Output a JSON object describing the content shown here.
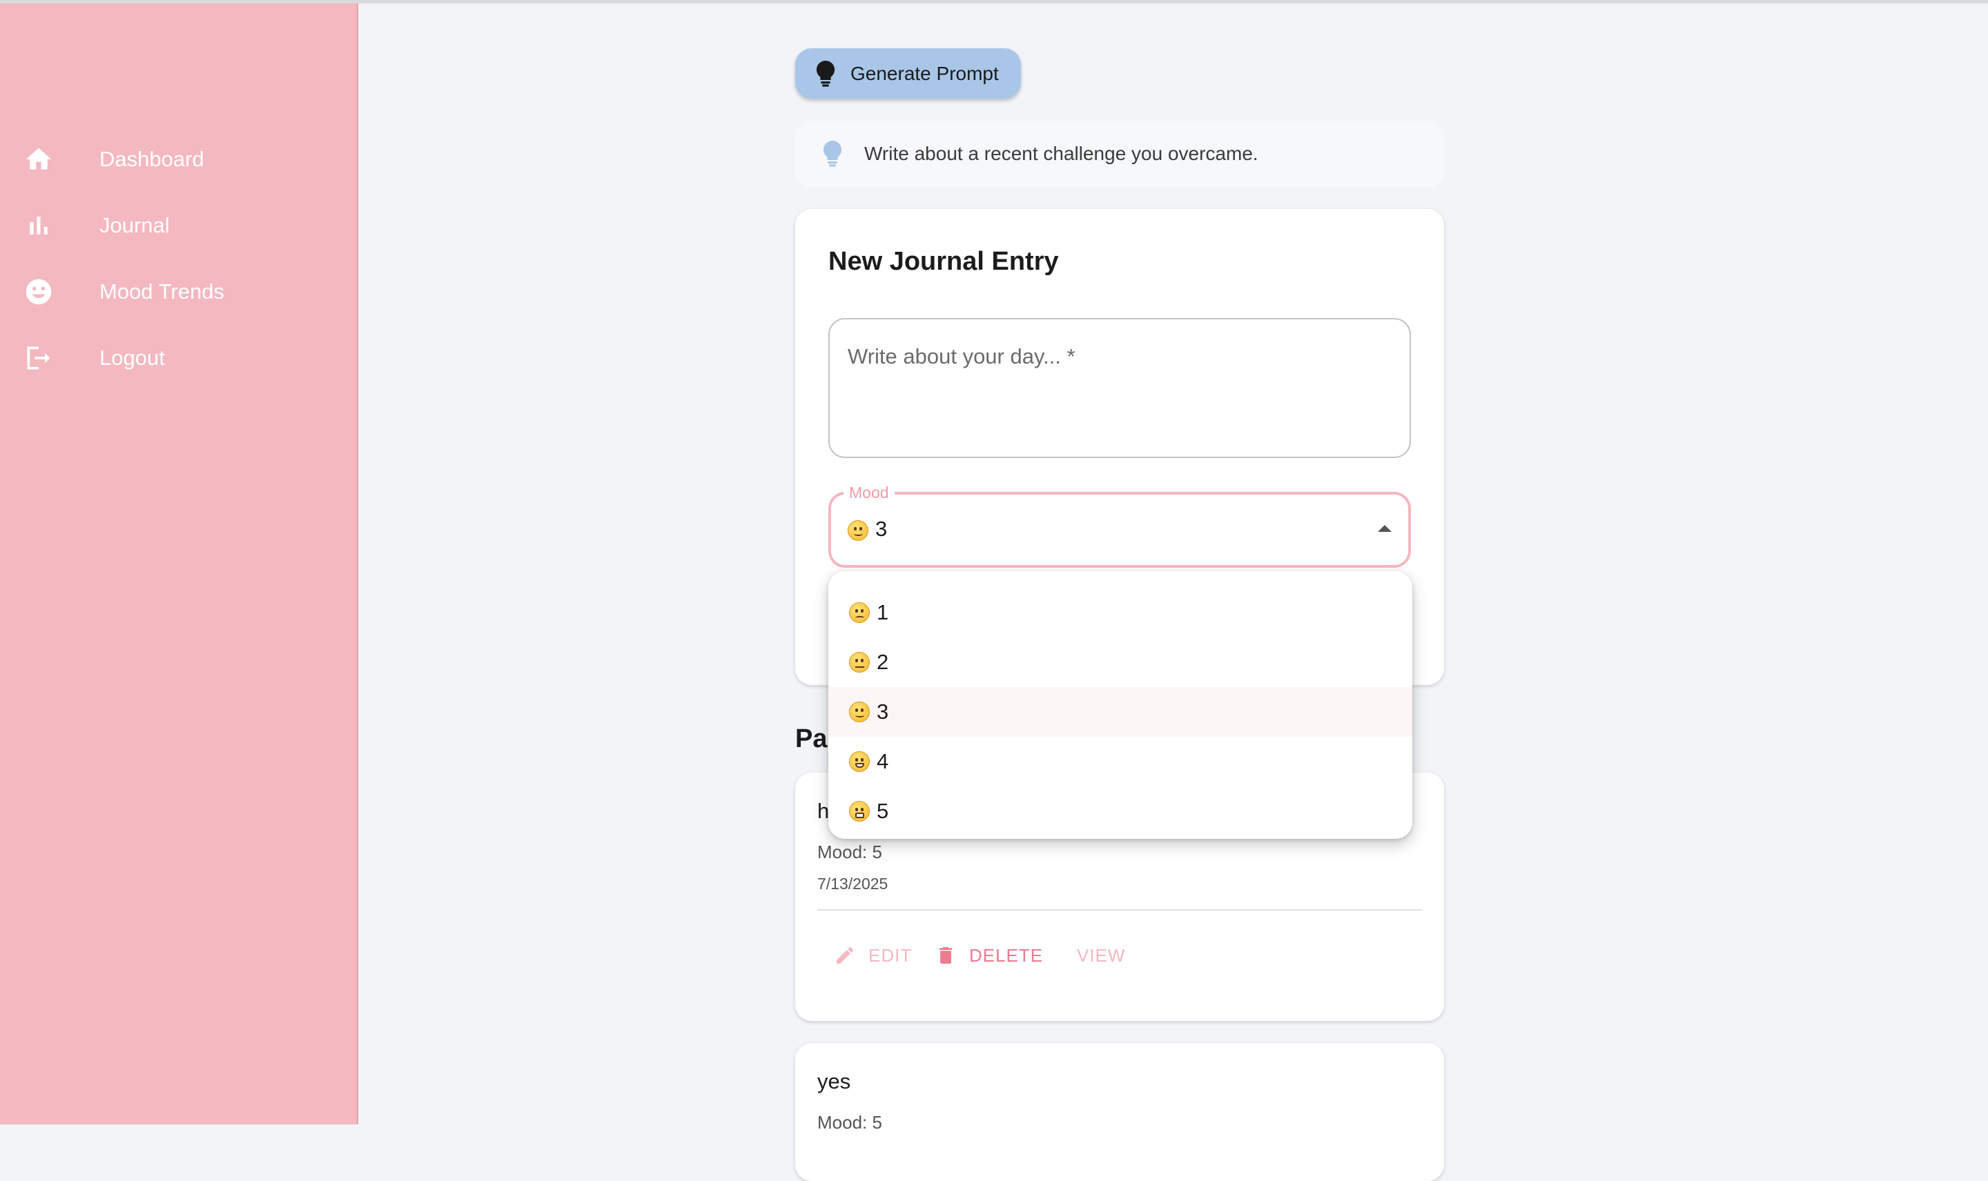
{
  "sidebar": {
    "items": [
      {
        "label": "Dashboard",
        "icon": "home-icon"
      },
      {
        "label": "Journal",
        "icon": "bar-chart-icon"
      },
      {
        "label": "Mood Trends",
        "icon": "smiley-icon"
      },
      {
        "label": "Logout",
        "icon": "logout-icon"
      }
    ]
  },
  "toolbar": {
    "generate_label": "Generate Prompt"
  },
  "prompt": {
    "text": "Write about a recent challenge you overcame."
  },
  "entry_form": {
    "title": "New Journal Entry",
    "textarea_placeholder": "Write about your day... *",
    "mood_label": "Mood",
    "mood_value": "3"
  },
  "mood_menu": {
    "options": [
      "1",
      "2",
      "3",
      "4",
      "5"
    ],
    "selected": "3"
  },
  "past": {
    "title_visible": "Pa",
    "entries": [
      {
        "text": "h",
        "mood": "Mood: 5",
        "date": "7/13/2025",
        "edit": "EDIT",
        "delete": "DELETE",
        "view": "VIEW"
      },
      {
        "text": "yes",
        "mood": "Mood: 5"
      }
    ]
  },
  "colors": {
    "sidebar_bg": "#f4b8c0",
    "accent": "#f4b8c0",
    "delete": "#ec7d8f",
    "generate_bg": "#a9c6e8",
    "page_bg": "#f3f4f8"
  }
}
